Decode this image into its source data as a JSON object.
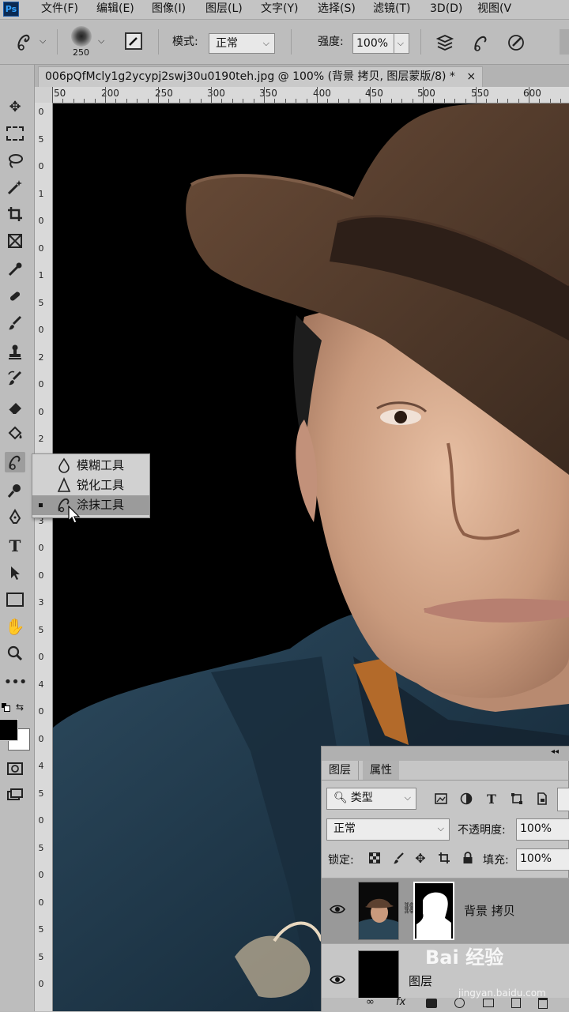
{
  "app": {
    "logo": "Ps"
  },
  "menu": [
    "文件(F)",
    "编辑(E)",
    "图像(I)",
    "图层(L)",
    "文字(Y)",
    "选择(S)",
    "滤镜(T)",
    "3D(D)",
    "视图(V"
  ],
  "options": {
    "brush_size": "250",
    "mode_label": "模式:",
    "mode_value": "正常",
    "strength_label": "强度:",
    "strength_value": "100%"
  },
  "document": {
    "tab_title": "006pQfMcly1g2ycypj2swj30u0190teh.jpg @ 100% (背景 拷贝, 图层蒙版/8) *",
    "close": "×"
  },
  "rulers": {
    "h_labels": [
      "50",
      "200",
      "250",
      "300",
      "350",
      "400",
      "450",
      "500",
      "550",
      "600"
    ],
    "v_labels": [
      "0",
      "5",
      "0",
      "1",
      "0",
      "0",
      "1",
      "5",
      "0",
      "2",
      "0",
      "0",
      "2",
      "5",
      "0",
      "3",
      "0",
      "0",
      "3",
      "5",
      "0",
      "4",
      "0",
      "0",
      "4",
      "5",
      "0",
      "5",
      "0",
      "0",
      "5",
      "5",
      "0"
    ]
  },
  "tool_flyout": {
    "items": [
      {
        "label": "模糊工具",
        "icon": "blur-drop-icon",
        "selected": false
      },
      {
        "label": "锐化工具",
        "icon": "sharpen-triangle-icon",
        "selected": false
      },
      {
        "label": "涂抹工具",
        "icon": "smudge-finger-icon",
        "selected": true
      }
    ]
  },
  "layers_panel": {
    "tabs": [
      "图层",
      "属性"
    ],
    "filter_label": "类型",
    "blend_mode": "正常",
    "opacity_label": "不透明度:",
    "opacity_value": "100%",
    "lock_label": "锁定:",
    "fill_label": "填充:",
    "fill_value": "100%",
    "layers": [
      {
        "name": "背景 拷贝",
        "selected": true
      },
      {
        "name": "图层"
      }
    ],
    "collapse": "◂◂"
  },
  "watermark": {
    "brand": "Bai 经验",
    "site": "jingyan.baidu.com"
  },
  "colors": {
    "foreground": "#000000",
    "background": "#ffffff",
    "canvas_bg": "#000000"
  }
}
